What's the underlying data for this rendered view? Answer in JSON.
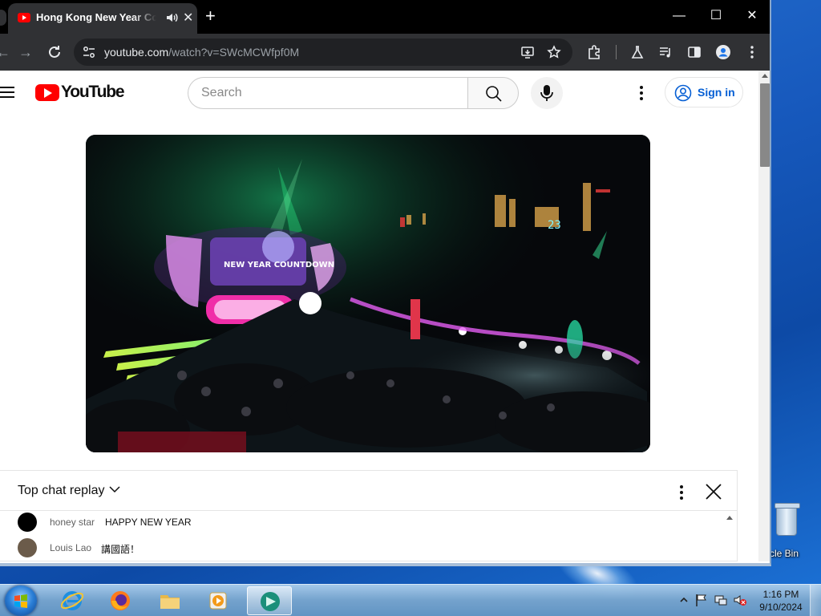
{
  "desktop": {
    "recycle_bin_label": "cle Bin"
  },
  "browser": {
    "tab": {
      "title": "Hong Kong New Year Countdown",
      "close_glyph": "✕"
    },
    "new_tab_glyph": "+",
    "window_controls": {
      "minimize": "—",
      "maximize": "☐",
      "close": "✕"
    },
    "address": {
      "host": "youtube.com",
      "path": "/watch?v=SWcMCWfpf0M"
    }
  },
  "youtube": {
    "wordmark": "YouTube",
    "search_placeholder": "Search",
    "sign_in_label": "Sign in",
    "video": {
      "stage_sign": "NEW YEAR COUNTDOWN",
      "clock_digits": "23"
    },
    "chat": {
      "title": "Top chat replay",
      "messages": [
        {
          "author": "honey star",
          "text": "HAPPY NEW YEAR",
          "avatar_color": "#000000"
        },
        {
          "author": "Louis Lao",
          "text": "講國語！",
          "avatar_color": "#6b5b4a"
        }
      ]
    }
  },
  "taskbar": {
    "clock": {
      "time": "1:16 PM",
      "date": "9/10/2024"
    },
    "apps": [
      "internet-explorer",
      "firefox",
      "file-explorer",
      "media-player",
      "active-app"
    ]
  },
  "colors": {
    "youtube_red": "#ff0000",
    "sign_in_blue": "#065fd4",
    "chrome_dark": "#303134"
  }
}
